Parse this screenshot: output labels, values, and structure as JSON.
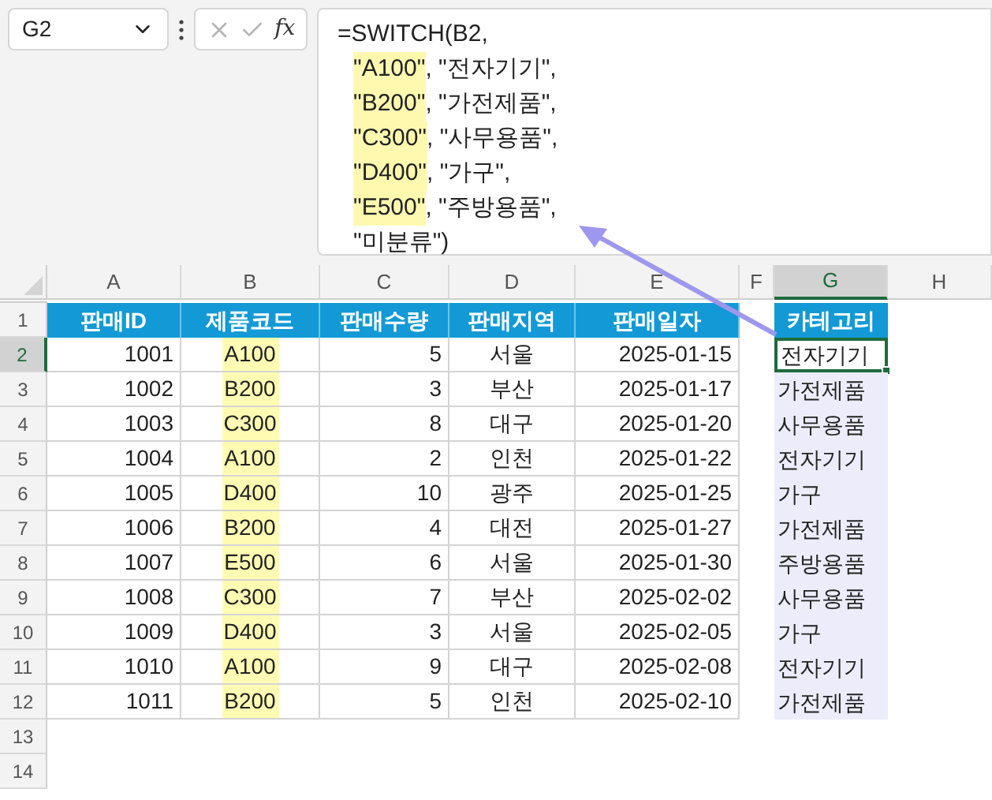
{
  "name_box": {
    "value": "G2"
  },
  "formula_bar": {
    "function_button": "fx",
    "lines": [
      {
        "text": "=SWITCH(B2,"
      },
      {
        "highlight": "\"A100\"",
        "text": ", \"전자기기\","
      },
      {
        "highlight": "\"B200\"",
        "text": ", \"가전제품\","
      },
      {
        "highlight": "\"C300\"",
        "text": ", \"사무용품\","
      },
      {
        "highlight": "\"D400\"",
        "text": ", \"가구\","
      },
      {
        "highlight": "\"E500\"",
        "text": ", \"주방용품\","
      },
      {
        "text": "\"미분류\")"
      }
    ]
  },
  "column_headers": [
    {
      "label": "A",
      "selected": false
    },
    {
      "label": "B",
      "selected": false
    },
    {
      "label": "C",
      "selected": false
    },
    {
      "label": "D",
      "selected": false
    },
    {
      "label": "E",
      "selected": false
    },
    {
      "label": "F",
      "selected": false
    },
    {
      "label": "G",
      "selected": true
    },
    {
      "label": "H",
      "selected": false
    }
  ],
  "row_headers": [
    {
      "label": "1",
      "selected": false
    },
    {
      "label": "2",
      "selected": true
    },
    {
      "label": "3",
      "selected": false
    },
    {
      "label": "4",
      "selected": false
    },
    {
      "label": "5",
      "selected": false
    },
    {
      "label": "6",
      "selected": false
    },
    {
      "label": "7",
      "selected": false
    },
    {
      "label": "8",
      "selected": false
    },
    {
      "label": "9",
      "selected": false
    },
    {
      "label": "10",
      "selected": false
    },
    {
      "label": "11",
      "selected": false
    },
    {
      "label": "12",
      "selected": false
    },
    {
      "label": "13",
      "selected": false
    },
    {
      "label": "14",
      "selected": false
    }
  ],
  "table": {
    "columns": [
      "판매ID",
      "제품코드",
      "판매수량",
      "판매지역",
      "판매일자"
    ],
    "category_header": "카테고리",
    "rows": [
      {
        "id": "1001",
        "code": "A100",
        "qty": "5",
        "region": "서울",
        "date": "2025-01-15",
        "category": "전자기기",
        "selected": true
      },
      {
        "id": "1002",
        "code": "B200",
        "qty": "3",
        "region": "부산",
        "date": "2025-01-17",
        "category": "가전제품",
        "selected": false
      },
      {
        "id": "1003",
        "code": "C300",
        "qty": "8",
        "region": "대구",
        "date": "2025-01-20",
        "category": "사무용품",
        "selected": false
      },
      {
        "id": "1004",
        "code": "A100",
        "qty": "2",
        "region": "인천",
        "date": "2025-01-22",
        "category": "전자기기",
        "selected": false
      },
      {
        "id": "1005",
        "code": "D400",
        "qty": "10",
        "region": "광주",
        "date": "2025-01-25",
        "category": "가구",
        "selected": false
      },
      {
        "id": "1006",
        "code": "B200",
        "qty": "4",
        "region": "대전",
        "date": "2025-01-27",
        "category": "가전제품",
        "selected": false
      },
      {
        "id": "1007",
        "code": "E500",
        "qty": "6",
        "region": "서울",
        "date": "2025-01-30",
        "category": "주방용품",
        "selected": false
      },
      {
        "id": "1008",
        "code": "C300",
        "qty": "7",
        "region": "부산",
        "date": "2025-02-02",
        "category": "사무용품",
        "selected": false
      },
      {
        "id": "1009",
        "code": "D400",
        "qty": "3",
        "region": "서울",
        "date": "2025-02-05",
        "category": "가구",
        "selected": false
      },
      {
        "id": "1010",
        "code": "A100",
        "qty": "9",
        "region": "대구",
        "date": "2025-02-08",
        "category": "전자기기",
        "selected": false
      },
      {
        "id": "1011",
        "code": "B200",
        "qty": "5",
        "region": "인천",
        "date": "2025-02-10",
        "category": "가전제품",
        "selected": false
      }
    ]
  }
}
